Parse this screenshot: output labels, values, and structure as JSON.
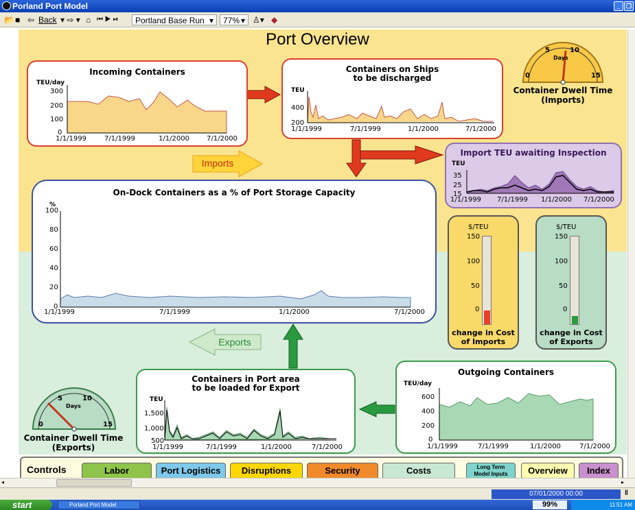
{
  "window": {
    "title": "Porland Port Model"
  },
  "toolbar": {
    "back_label": "Back",
    "run_selector": "Portland Base Run",
    "zoom": "77%"
  },
  "page_title": "Port Overview",
  "incoming": {
    "title": "Incoming Containers",
    "unit": "TEU/day",
    "yticks": [
      "300",
      "200",
      "100",
      "0"
    ],
    "xticks": [
      "1/1/1999",
      "7/1/1999",
      "1/1/2000",
      "7/1/2000"
    ]
  },
  "ships": {
    "title_line1": "Containers on Ships",
    "title_line2": "to be discharged",
    "unit": "TEU",
    "yticks": [
      "400",
      "200"
    ],
    "xticks": [
      "1/1/1999",
      "7/1/1999",
      "1/1/2000",
      "7/1/2000"
    ]
  },
  "dwell_imports": {
    "title_line1": "Container Dwell Time",
    "title_line2": "(Imports)",
    "unit": "Days",
    "ticks": [
      "0",
      "5",
      "10",
      "15"
    ],
    "value": 9.5
  },
  "inspection": {
    "title": "Import TEU awaiting Inspection",
    "unit": "TEU",
    "yticks": [
      "35",
      "25",
      "15"
    ],
    "xticks": [
      "1/1/1999",
      "7/1/1999",
      "1/1/2000",
      "7/1/2000"
    ]
  },
  "imports_label": "Imports",
  "exports_label": "Exports",
  "ondock": {
    "title": "On-Dock Containers as a % of Port Storage Capacity",
    "unit": "%",
    "yticks": [
      "100",
      "80",
      "60",
      "40",
      "20",
      "0"
    ],
    "xticks": [
      "1/1/1999",
      "7/1/1999",
      "1/1/2000",
      "7/1/2000"
    ]
  },
  "cost_imports": {
    "unit": "$/TEU",
    "ticks": [
      "150",
      "100",
      "50",
      "0"
    ],
    "label_line1": "change in Cost",
    "label_line2": "of Imports",
    "value": 24,
    "color": "#e8402a"
  },
  "cost_exports": {
    "unit": "$/TEU",
    "ticks": [
      "150",
      "100",
      "50",
      "0"
    ],
    "label_line1": "change in Cost",
    "label_line2": "of Exports",
    "value": 14,
    "color": "#2a9a40"
  },
  "outgoing": {
    "title": "Outgoing Containers",
    "unit": "TEU/day",
    "yticks": [
      "600",
      "400",
      "200",
      "0"
    ],
    "xticks": [
      "1/1/1999",
      "7/1/1999",
      "1/1/2000",
      "7/1/2000"
    ]
  },
  "loading": {
    "title_line1": "Containers in Port area",
    "title_line2": "to be loaded for Export",
    "unit": "TEU",
    "yticks": [
      "1,500",
      "1,000",
      "500"
    ],
    "xticks": [
      "1/1/1999",
      "7/1/1999",
      "1/1/2000",
      "7/1/2000"
    ]
  },
  "dwell_exports": {
    "title_line1": "Container Dwell Time",
    "title_line2": "(Exports)",
    "unit": "Days",
    "ticks": [
      "0",
      "5",
      "10",
      "15"
    ],
    "value": 3.5
  },
  "controls": {
    "label": "Controls",
    "labor": "Labor",
    "port_logistics": "Port Logistics",
    "disruptions": "Disruptions",
    "security": "Security",
    "costs": "Costs",
    "long_term_line1": "Long Term",
    "long_term_line2": "Model Inputs",
    "overview": "Overview",
    "index": "Index"
  },
  "status": {
    "datetime": "07/01/2000 00:00",
    "progress": "99%"
  },
  "taskbar": {
    "start": "start",
    "task": "Porland Port Model",
    "clock": "11:51 AM"
  },
  "colors": {
    "imports_bg": "#fbe48f",
    "exports_bg": "#d9eedc",
    "red_arrow": "#e03a1e",
    "green_arrow": "#2a9a40"
  }
}
